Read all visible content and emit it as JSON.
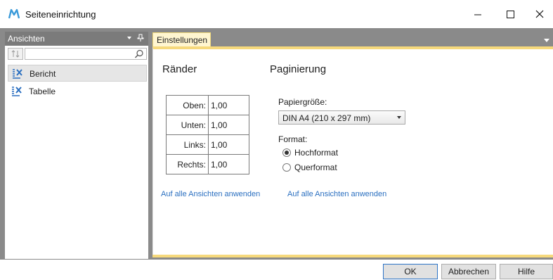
{
  "window": {
    "title": "Seiteneinrichtung",
    "icon": "m-logo-icon",
    "controls": [
      "minimize-icon",
      "maximize-icon",
      "close-icon"
    ]
  },
  "views_pane": {
    "header": "Ansichten",
    "search_placeholder": "",
    "items": [
      {
        "label": "Bericht",
        "icon": "report-view-icon",
        "selected": true
      },
      {
        "label": "Tabelle",
        "icon": "table-view-icon",
        "selected": false
      }
    ]
  },
  "tabs": [
    {
      "label": "Einstellungen",
      "active": true
    }
  ],
  "margins": {
    "title": "Ränder",
    "rows": [
      {
        "label": "Oben:",
        "value": "1,00"
      },
      {
        "label": "Unten:",
        "value": "1,00"
      },
      {
        "label": "Links:",
        "value": "1,00"
      },
      {
        "label": "Rechts:",
        "value": "1,00"
      }
    ],
    "apply_link": "Auf alle Ansichten anwenden"
  },
  "pagination": {
    "title": "Paginierung",
    "paper_size_label": "Papiergröße:",
    "paper_size_value": "DIN A4 (210 x 297 mm)",
    "format_label": "Format:",
    "formats": [
      {
        "label": "Hochformat",
        "checked": true
      },
      {
        "label": "Querformat",
        "checked": false
      }
    ],
    "apply_link": "Auf alle Ansichten anwenden"
  },
  "buttons": {
    "ok": "OK",
    "cancel": "Abbrechen",
    "help": "Hilfe"
  },
  "colors": {
    "accent_tab": "#fff6d0",
    "accent_band": "#f6d97c",
    "link": "#2a6fc0",
    "frame": "#8a8a8a"
  }
}
